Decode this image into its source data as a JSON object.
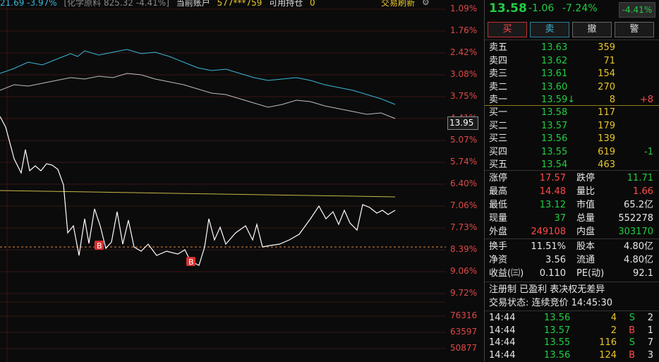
{
  "header": {
    "price_change": "21.69 -3.97%",
    "index_name": "[化学原料 825.32 -4.41%]",
    "account_label": "当前账户",
    "account_value": "577***759",
    "holdings_label": "可用持仓",
    "holdings_value": "0",
    "refresh_label": "交易刷新"
  },
  "axis_labels": [
    "1.09%",
    "1.76%",
    "2.42%",
    "3.08%",
    "3.75%",
    "4.41%",
    "5.07%",
    "5.74%",
    "6.40%",
    "7.06%",
    "7.73%",
    "8.39%",
    "9.06%",
    "9.72%"
  ],
  "volume_labels": [
    "76316",
    "63597",
    "50877"
  ],
  "current_price_tag": "13.95",
  "quote": {
    "price": "13.58",
    "change": "-1.06",
    "pct": "-7.24%",
    "badge": "-4.41%"
  },
  "buttons": {
    "buy": "买",
    "sell": "卖",
    "cancel": "撤",
    "alert": "警"
  },
  "asks": [
    {
      "label": "卖五",
      "price": "13.63",
      "vol": "359",
      "delta": ""
    },
    {
      "label": "卖四",
      "price": "13.62",
      "vol": "71",
      "delta": ""
    },
    {
      "label": "卖三",
      "price": "13.61",
      "vol": "154",
      "delta": ""
    },
    {
      "label": "卖二",
      "price": "13.60",
      "vol": "270",
      "delta": ""
    },
    {
      "label": "卖一",
      "price": "13.59↓",
      "vol": "8",
      "delta": "+8"
    }
  ],
  "bids": [
    {
      "label": "买一",
      "price": "13.58",
      "vol": "117",
      "delta": ""
    },
    {
      "label": "买二",
      "price": "13.57",
      "vol": "179",
      "delta": ""
    },
    {
      "label": "买三",
      "price": "13.56",
      "vol": "139",
      "delta": ""
    },
    {
      "label": "买四",
      "price": "13.55",
      "vol": "619",
      "delta": "-1"
    },
    {
      "label": "买五",
      "price": "13.54",
      "vol": "463",
      "delta": ""
    }
  ],
  "stats": [
    {
      "l1": "涨停",
      "v1": "17.57",
      "l2": "跌停",
      "v2": "11.71"
    },
    {
      "l1": "最高",
      "v1": "14.48",
      "l2": "量比",
      "v2": "1.66"
    },
    {
      "l1": "最低",
      "v1": "13.12",
      "l2": "市值",
      "v2": "65.2亿"
    },
    {
      "l1": "现量",
      "v1": "37",
      "l2": "总量",
      "v2": "552278"
    },
    {
      "l1": "外盘",
      "v1": "249108",
      "l2": "内盘",
      "v2": "303170"
    }
  ],
  "stats2": [
    {
      "l1": "换手",
      "v1": "11.51%",
      "l2": "股本",
      "v2": "4.80亿"
    },
    {
      "l1": "净资",
      "v1": "3.56",
      "l2": "流通",
      "v2": "4.80亿"
    },
    {
      "l1": "收益(㈢)",
      "v1": "0.110",
      "l2": "PE(动)",
      "v2": "92.1"
    }
  ],
  "info_line": "注册制 已盈利 表决权无差异",
  "status_line": "交易状态: 连续竞价 14:45:30",
  "ticks": [
    {
      "time": "14:44",
      "price": "13.56",
      "vol": "4",
      "side": "S",
      "n": "2"
    },
    {
      "time": "14:44",
      "price": "13.57",
      "vol": "2",
      "side": "B",
      "n": "1"
    },
    {
      "time": "14:44",
      "price": "13.55",
      "vol": "116",
      "side": "S",
      "n": "7"
    },
    {
      "time": "14:44",
      "price": "13.56",
      "vol": "124",
      "side": "B",
      "n": "3"
    }
  ],
  "markers": [
    "B",
    "B"
  ],
  "colors": {
    "up": "#ff4a4a",
    "down": "#22cc44",
    "vol": "#e8c62a"
  }
}
